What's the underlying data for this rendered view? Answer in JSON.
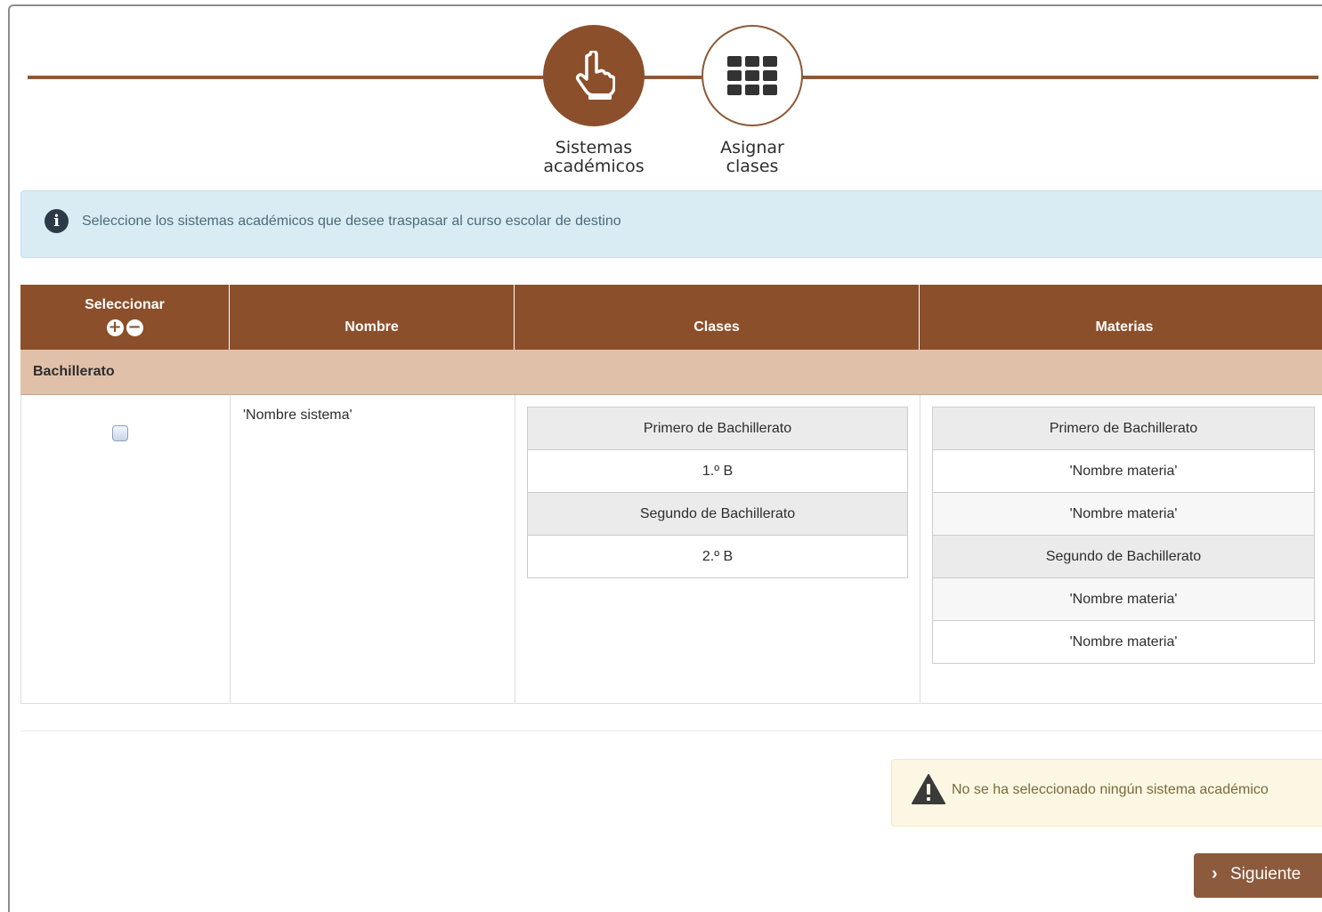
{
  "steps": [
    {
      "label": "Sistemas\nacadémicos",
      "line1": "Sistemas",
      "line2": "académicos",
      "icon": "hand-pointer-icon",
      "state": "active"
    },
    {
      "label": "Asignar clases",
      "line1": "Asignar",
      "line2": "clases",
      "icon": "grid-icon",
      "state": "inactive"
    }
  ],
  "info": {
    "icon": "info-icon",
    "text": "Seleccione los sistemas académicos que desee traspasar al curso escolar de destino"
  },
  "table": {
    "headers": {
      "select": "Seleccionar",
      "name": "Nombre",
      "classes": "Clases",
      "subjects": "Materias"
    },
    "group": "Bachillerato",
    "row": {
      "name": "'Nombre sistema'",
      "classes": [
        {
          "type": "head",
          "text": "Primero de Bachillerato"
        },
        {
          "type": "plain",
          "text": "1.º B"
        },
        {
          "type": "head",
          "text": "Segundo de Bachillerato"
        },
        {
          "type": "plain",
          "text": "2.º B"
        }
      ],
      "subjects": [
        {
          "type": "head",
          "text": "Primero de Bachillerato"
        },
        {
          "type": "plain",
          "text": "'Nombre materia'"
        },
        {
          "type": "alt",
          "text": "'Nombre materia'"
        },
        {
          "type": "head",
          "text": "Segundo de Bachillerato"
        },
        {
          "type": "alt",
          "text": "'Nombre materia'"
        },
        {
          "type": "plain",
          "text": "'Nombre materia'"
        }
      ]
    }
  },
  "warning": {
    "icon": "warning-icon",
    "text": "No se ha seleccionado ningún sistema académico"
  },
  "next_button": {
    "label": "Siguiente"
  },
  "colors": {
    "brand": "#8b4f2b",
    "group_row": "#e1c0aa",
    "info_bg": "#d9ecf4",
    "warning_bg": "#fcf7e3"
  }
}
